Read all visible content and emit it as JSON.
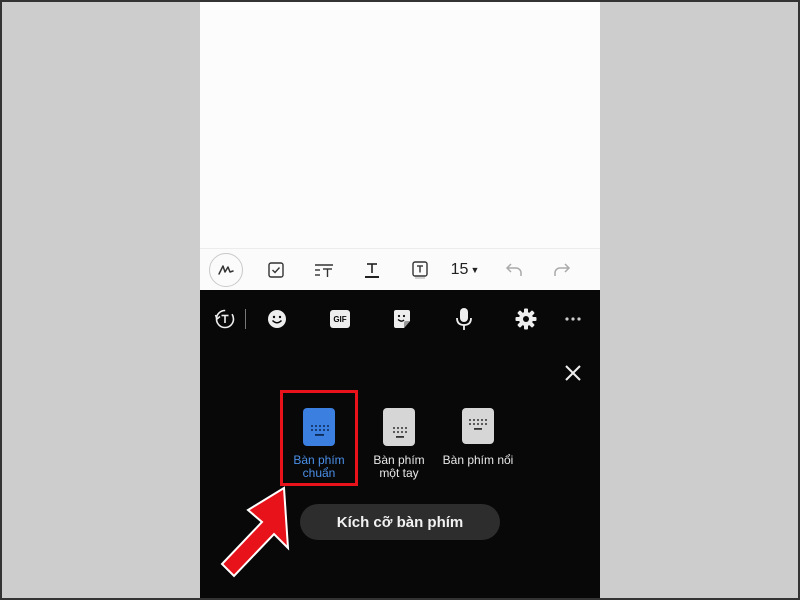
{
  "toolbar": {
    "font_size": "15",
    "icons": [
      "handwriting-pen-icon",
      "checkbox-icon",
      "paragraph-style-icon",
      "text-style-icon",
      "text-box-icon",
      "undo-icon",
      "redo-icon"
    ]
  },
  "keyboard_top": {
    "icons": [
      "text-translate-icon",
      "emoji-icon",
      "gif-icon",
      "sticker-icon",
      "microphone-icon",
      "settings-icon",
      "more-icon"
    ],
    "gif_label": "GIF"
  },
  "modes": [
    {
      "label_line1": "Bàn phím",
      "label_line2": "chuẩn",
      "selected": true
    },
    {
      "label_line1": "Bàn phím",
      "label_line2": "một tay",
      "selected": false
    },
    {
      "label_line1": "Bàn phím nổi",
      "label_line2": "",
      "selected": false
    }
  ],
  "size_button_label": "Kích cỡ bàn phím",
  "colors": {
    "selected_blue": "#4a8fe8",
    "highlight_red": "#e8121a",
    "keyboard_bg": "#080808",
    "outer_bg": "#cdcdcd"
  }
}
